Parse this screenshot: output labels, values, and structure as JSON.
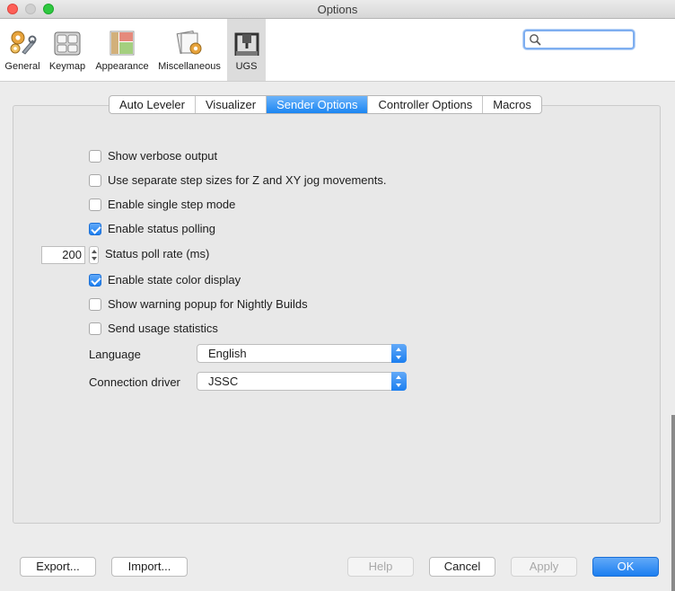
{
  "window": {
    "title": "Options"
  },
  "categories": [
    {
      "label": "General",
      "icon": "gears-wrench-icon",
      "selected": false
    },
    {
      "label": "Keymap",
      "icon": "keyboard-icon",
      "selected": false
    },
    {
      "label": "Appearance",
      "icon": "appearance-panels-icon",
      "selected": false
    },
    {
      "label": "Miscellaneous",
      "icon": "miscellaneous-icon",
      "selected": false
    },
    {
      "label": "UGS",
      "icon": "ugs-cnc-machine-icon",
      "selected": true
    }
  ],
  "search": {
    "value": "",
    "placeholder": ""
  },
  "tabs": [
    {
      "label": "Auto Leveler",
      "active": false
    },
    {
      "label": "Visualizer",
      "active": false
    },
    {
      "label": "Sender Options",
      "active": true
    },
    {
      "label": "Controller Options",
      "active": false
    },
    {
      "label": "Macros",
      "active": false
    }
  ],
  "options": [
    {
      "label": "Show verbose output",
      "checked": false
    },
    {
      "label": "Use separate step sizes for Z and XY jog movements.",
      "checked": false
    },
    {
      "label": "Enable single step mode",
      "checked": false
    },
    {
      "label": "Enable status polling",
      "checked": true
    },
    {
      "label": "Enable state color display",
      "checked": true
    },
    {
      "label": "Show warning popup for Nightly Builds",
      "checked": false
    },
    {
      "label": "Send usage statistics",
      "checked": false
    }
  ],
  "poll_rate": {
    "value": "200",
    "label": "Status poll rate (ms)"
  },
  "language": {
    "label": "Language",
    "value": "English"
  },
  "connection_driver": {
    "label": "Connection driver",
    "value": "JSSC"
  },
  "buttons": {
    "export": "Export...",
    "import": "Import...",
    "help": "Help",
    "cancel": "Cancel",
    "apply": "Apply",
    "ok": "OK"
  },
  "colors": {
    "accent": "#1c86f2",
    "close": "#fd5f57",
    "maximize": "#2fc840"
  }
}
